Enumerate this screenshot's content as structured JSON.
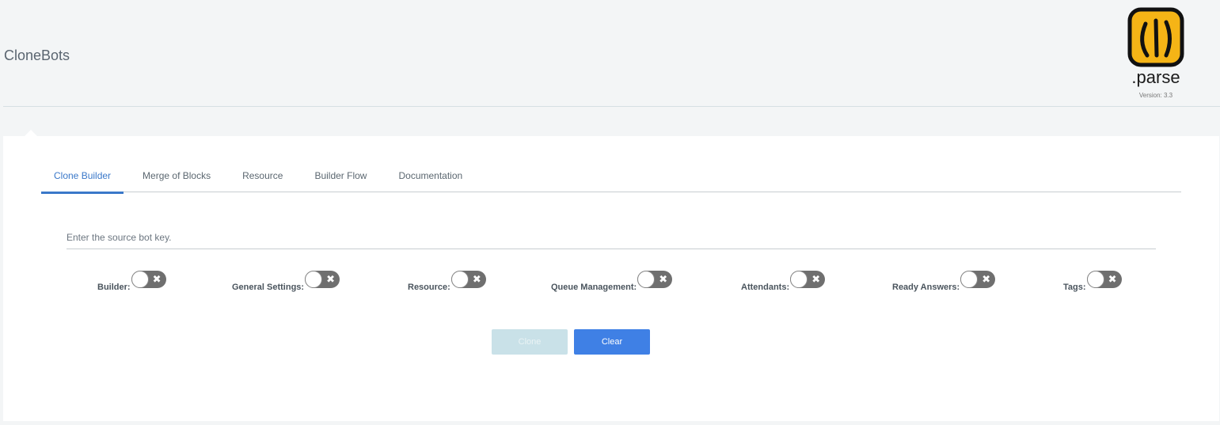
{
  "header": {
    "app_title": "CloneBots",
    "logo_text": ".parse",
    "version": "Version: 3.3"
  },
  "tabs": [
    {
      "label": "Clone Builder",
      "active": true
    },
    {
      "label": "Merge of Blocks",
      "active": false
    },
    {
      "label": "Resource",
      "active": false
    },
    {
      "label": "Builder Flow",
      "active": false
    },
    {
      "label": "Documentation",
      "active": false
    }
  ],
  "source_input": {
    "placeholder": "Enter the source bot key.",
    "value": ""
  },
  "toggles": [
    {
      "label": "Builder:",
      "on": false
    },
    {
      "label": "General Settings:",
      "on": false
    },
    {
      "label": "Resource:",
      "on": false
    },
    {
      "label": "Queue Management:",
      "on": false
    },
    {
      "label": "Attendants:",
      "on": false
    },
    {
      "label": "Ready Answers:",
      "on": false
    },
    {
      "label": "Tags:",
      "on": false
    }
  ],
  "toggle_off_glyph": "✖",
  "buttons": {
    "clone_label": "Clone",
    "clear_label": "Clear"
  },
  "colors": {
    "accent": "#3a78c9",
    "clear_button": "#3f80e5",
    "clone_button_disabled": "#c9e1e8",
    "toggle_off": "#6f6f6f"
  }
}
